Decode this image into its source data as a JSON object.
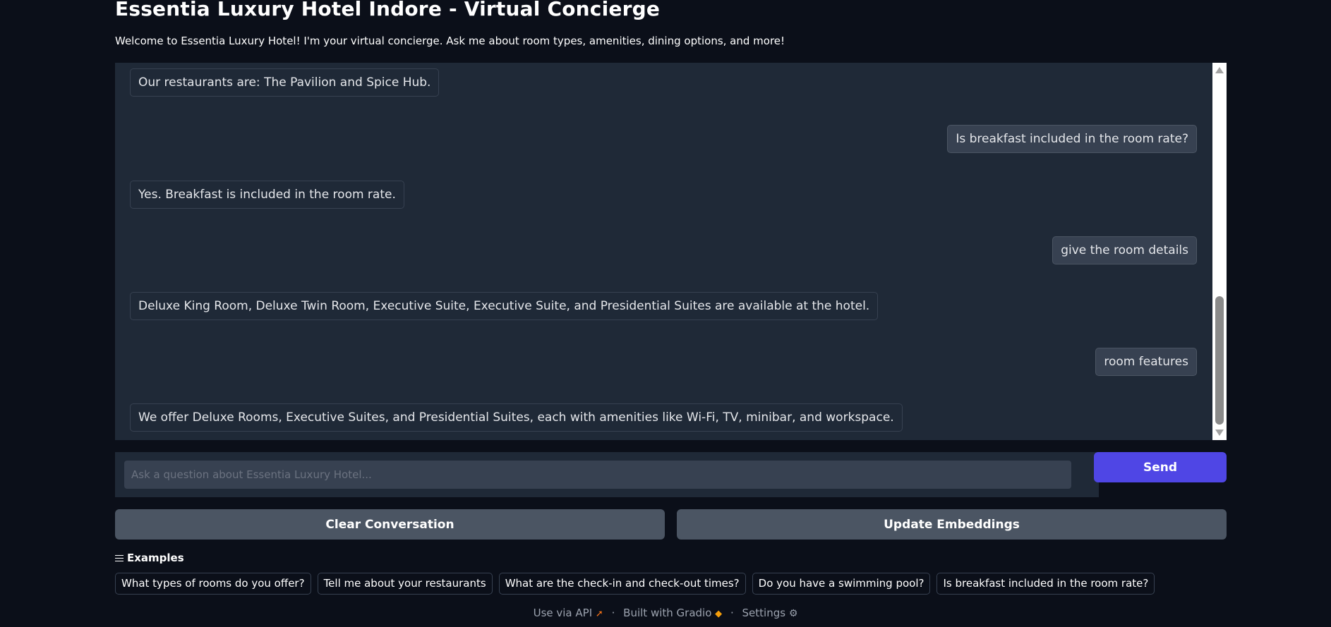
{
  "header": {
    "title": "Essentia Luxury Hotel Indore - Virtual Concierge",
    "subtitle": "Welcome to Essentia Luxury Hotel! I'm your virtual concierge. Ask me about room types, amenities, dining options, and more!"
  },
  "chat": {
    "messages": [
      {
        "role": "bot",
        "text": "Our restaurants are: The Pavilion and Spice Hub."
      },
      {
        "role": "user",
        "text": "Is breakfast included in the room rate?"
      },
      {
        "role": "bot",
        "text": "Yes. Breakfast is included in the room rate."
      },
      {
        "role": "user",
        "text": "give the room details"
      },
      {
        "role": "bot",
        "text": "Deluxe King Room, Deluxe Twin Room, Executive Suite, Executive Suite, and Presidential Suites are available at the hotel."
      },
      {
        "role": "user",
        "text": "room features"
      },
      {
        "role": "bot",
        "text": "We offer Deluxe Rooms, Executive Suites, and Presidential Suites, each with amenities like Wi-Fi, TV, minibar, and workspace."
      }
    ]
  },
  "input": {
    "placeholder": "Ask a question about Essentia Luxury Hotel...",
    "value": ""
  },
  "buttons": {
    "send": "Send",
    "clear": "Clear Conversation",
    "update": "Update Embeddings"
  },
  "examples": {
    "label": "Examples",
    "items": [
      "What types of rooms do you offer?",
      "Tell me about your restaurants",
      "What are the check-in and check-out times?",
      "Do you have a swimming pool?",
      "Is breakfast included in the room rate?"
    ]
  },
  "footer": {
    "api": "Use via API",
    "separator": "·",
    "built": "Built with Gradio",
    "settings": "Settings"
  },
  "colors": {
    "background": "#0b0f19",
    "panel": "#1f2937",
    "accent": "#4f46e5",
    "button": "#4b5563"
  },
  "icons": [
    "list-icon",
    "rocket-icon",
    "gradio-logo-icon",
    "gear-icon"
  ]
}
